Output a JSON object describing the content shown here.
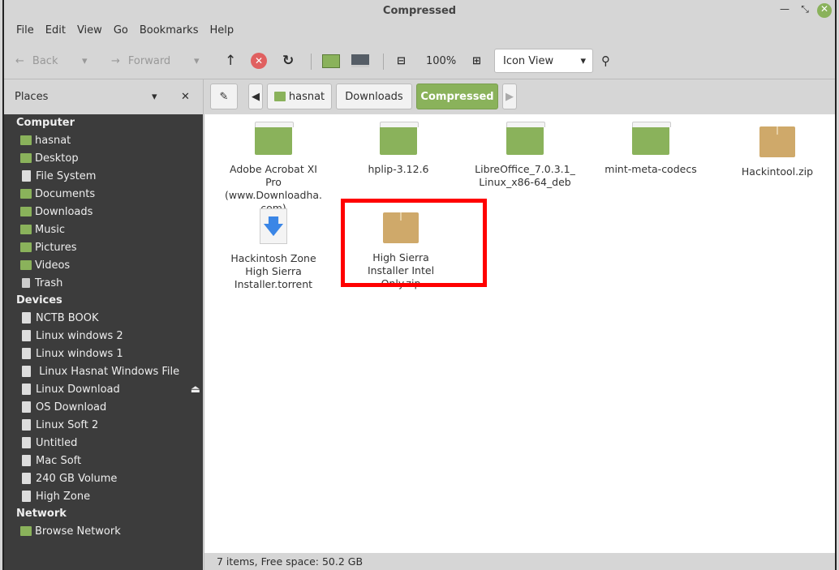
{
  "window": {
    "title": "Compressed"
  },
  "menu": [
    "File",
    "Edit",
    "View",
    "Go",
    "Bookmarks",
    "Help"
  ],
  "toolbar": {
    "back": "Back",
    "forward": "Forward",
    "zoom": "100%",
    "view": "Icon View"
  },
  "places": {
    "title": "Places"
  },
  "sidebar": {
    "computer": {
      "heading": "Computer",
      "items": [
        "hasnat",
        "Desktop",
        "File System",
        "Documents",
        "Downloads",
        "Music",
        "Pictures",
        "Videos",
        "Trash"
      ]
    },
    "devices": {
      "heading": "Devices",
      "items": [
        "NCTB BOOK",
        "Linux windows 2",
        "Linux windows 1",
        " Linux Hasnat Windows File",
        "Linux Download",
        "OS Download",
        "Linux Soft 2",
        "Untitled",
        "Mac Soft",
        "240 GB Volume",
        "High Zone"
      ]
    },
    "network": {
      "heading": "Network",
      "items": [
        "Browse Network"
      ]
    }
  },
  "path": [
    "hasnat",
    "Downloads",
    "Compressed"
  ],
  "files": [
    {
      "name": "Adobe Acrobat XI Pro (www.Downloadha. com)",
      "type": "folder"
    },
    {
      "name": "hplip-3.12.6",
      "type": "folder"
    },
    {
      "name": "LibreOffice_7.0.3.1_ Linux_x86-64_deb",
      "type": "folder"
    },
    {
      "name": "mint-meta-codecs",
      "type": "folder"
    },
    {
      "name": "Hackintool.zip",
      "type": "zip"
    },
    {
      "name": "Hackintosh Zone High Sierra Installer.torrent",
      "type": "torrent"
    },
    {
      "name": "High Sierra Installer Intel Only.zip",
      "type": "zip"
    }
  ],
  "status": "7 items, Free space: 50.2 GB",
  "colors": {
    "accent": "#8ab25b",
    "sidebar": "#3c3c3c",
    "highlight": "#ff0000"
  }
}
